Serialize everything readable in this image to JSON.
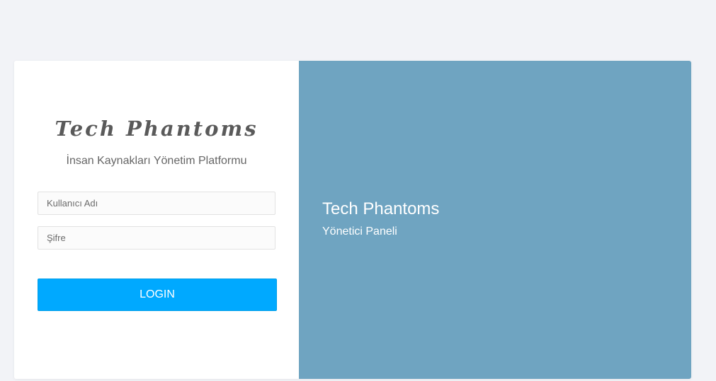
{
  "login_panel": {
    "logo_text": "Tech Phantoms",
    "subtitle": "İnsan Kaynakları Yönetim Platformu",
    "username_placeholder": "Kullanıcı Adı",
    "password_placeholder": "Şifre",
    "login_button": "LOGIN"
  },
  "info_panel": {
    "title": "Tech Phantoms",
    "subtitle": "Yönetici Paneli",
    "background_color": "#6fa4c1"
  },
  "colors": {
    "page_background": "#f2f3f7",
    "button": "#00a9ff"
  }
}
